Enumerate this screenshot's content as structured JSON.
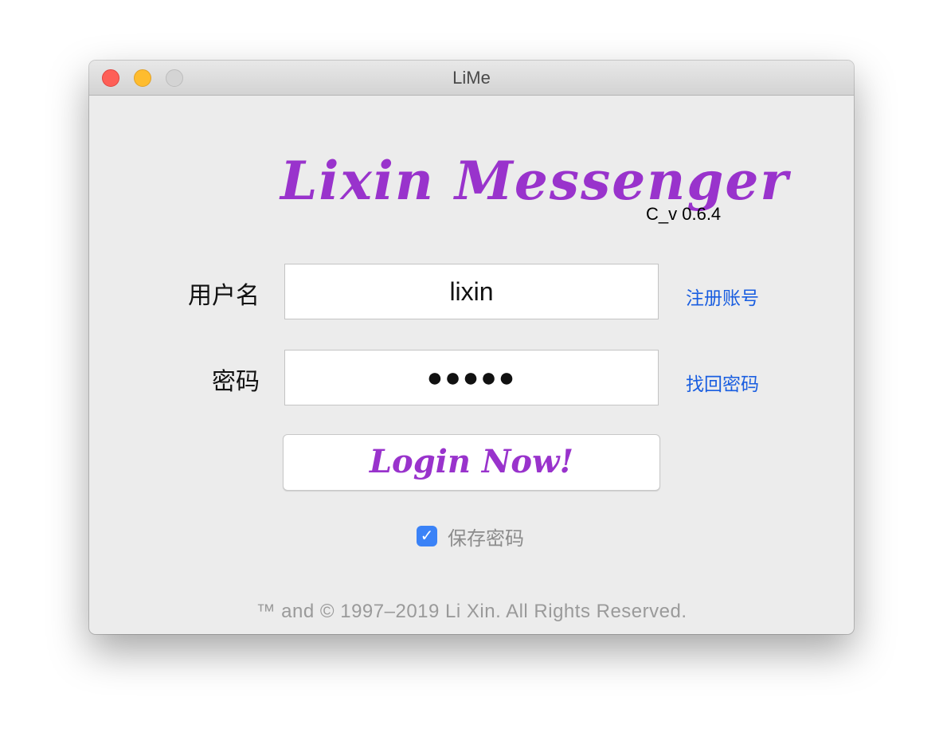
{
  "window": {
    "title": "LiMe"
  },
  "logo": {
    "text": "Lixin Messenger",
    "version": "C_v 0.6.4",
    "color": "#9933cc"
  },
  "form": {
    "username_label": "用户名",
    "username_value": "lixin",
    "password_label": "密码",
    "password_value": "●●●●●",
    "register_link": "注册账号",
    "forgot_link": "找回密码",
    "login_button": "Login Now!",
    "save_password_label": "保存密码",
    "save_password_checked": true,
    "checkbox_glyph": "✓"
  },
  "footer": {
    "text": "™ and © 1997–2019 Li Xin. All Rights Reserved."
  }
}
